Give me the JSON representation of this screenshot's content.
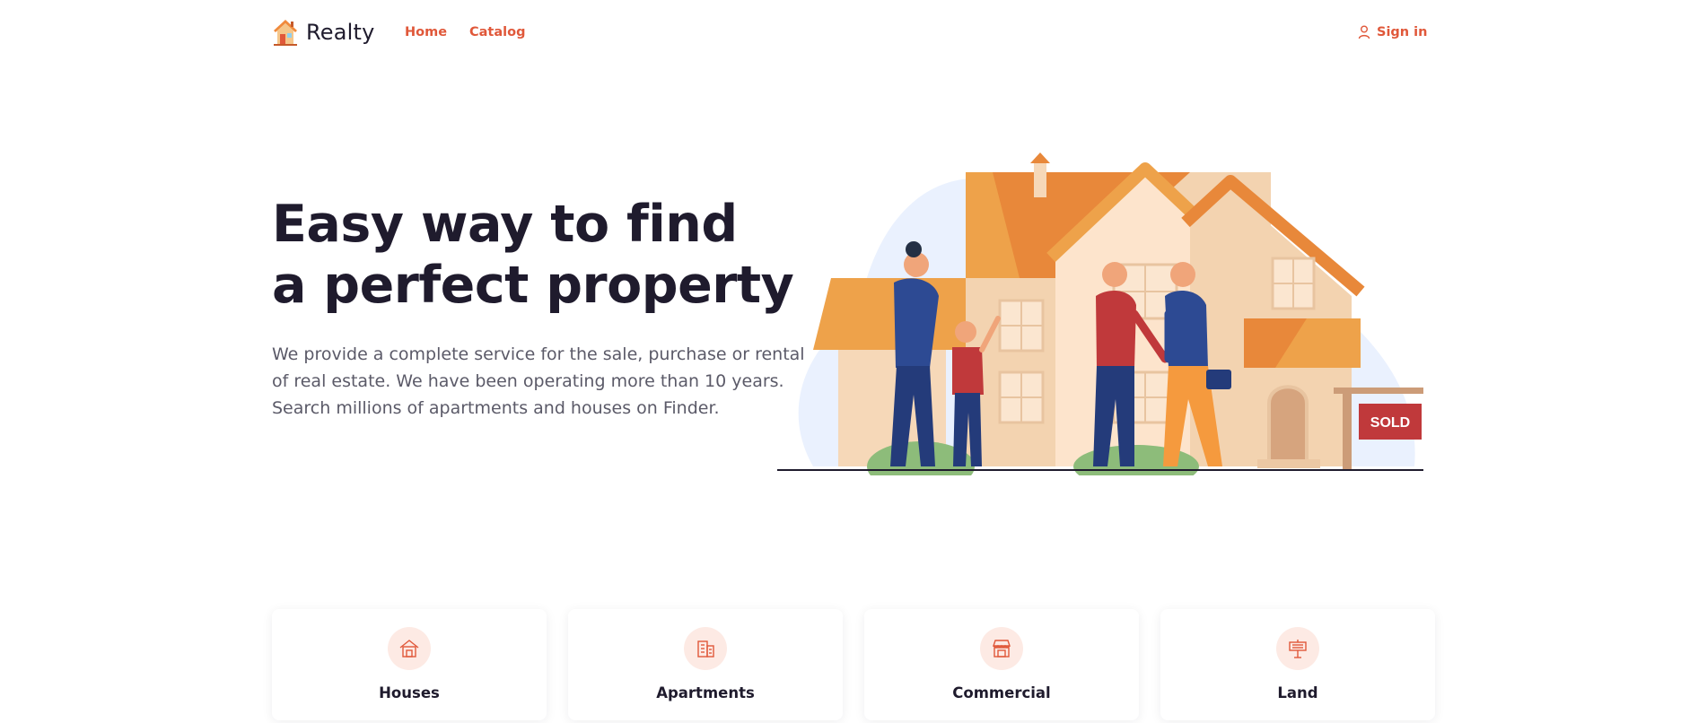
{
  "brand": {
    "name": "Realty",
    "logo_icon": "house-logo-icon"
  },
  "nav": {
    "home": "Home",
    "catalog": "Catalog"
  },
  "account": {
    "sign_in": "Sign in",
    "icon": "user-icon"
  },
  "hero": {
    "title_line1": "Easy way to find",
    "title_line2": "a perfect property",
    "description_lines": [
      "We provide a complete service for the sale, purchase or rental",
      "of real estate. We have been operating more than 10 years.",
      "Search millions of apartments and houses on Finder."
    ],
    "illustration_sign": "SOLD"
  },
  "categories": [
    {
      "label": "Houses",
      "icon": "house-icon"
    },
    {
      "label": "Apartments",
      "icon": "building-icon"
    },
    {
      "label": "Commercial",
      "icon": "shop-icon"
    },
    {
      "label": "Land",
      "icon": "rent-sign-icon"
    }
  ],
  "colors": {
    "accent": "#e0583a",
    "text": "#1f1b2d",
    "muted": "#5b5a68",
    "icon_bg": "#fdeae4"
  }
}
